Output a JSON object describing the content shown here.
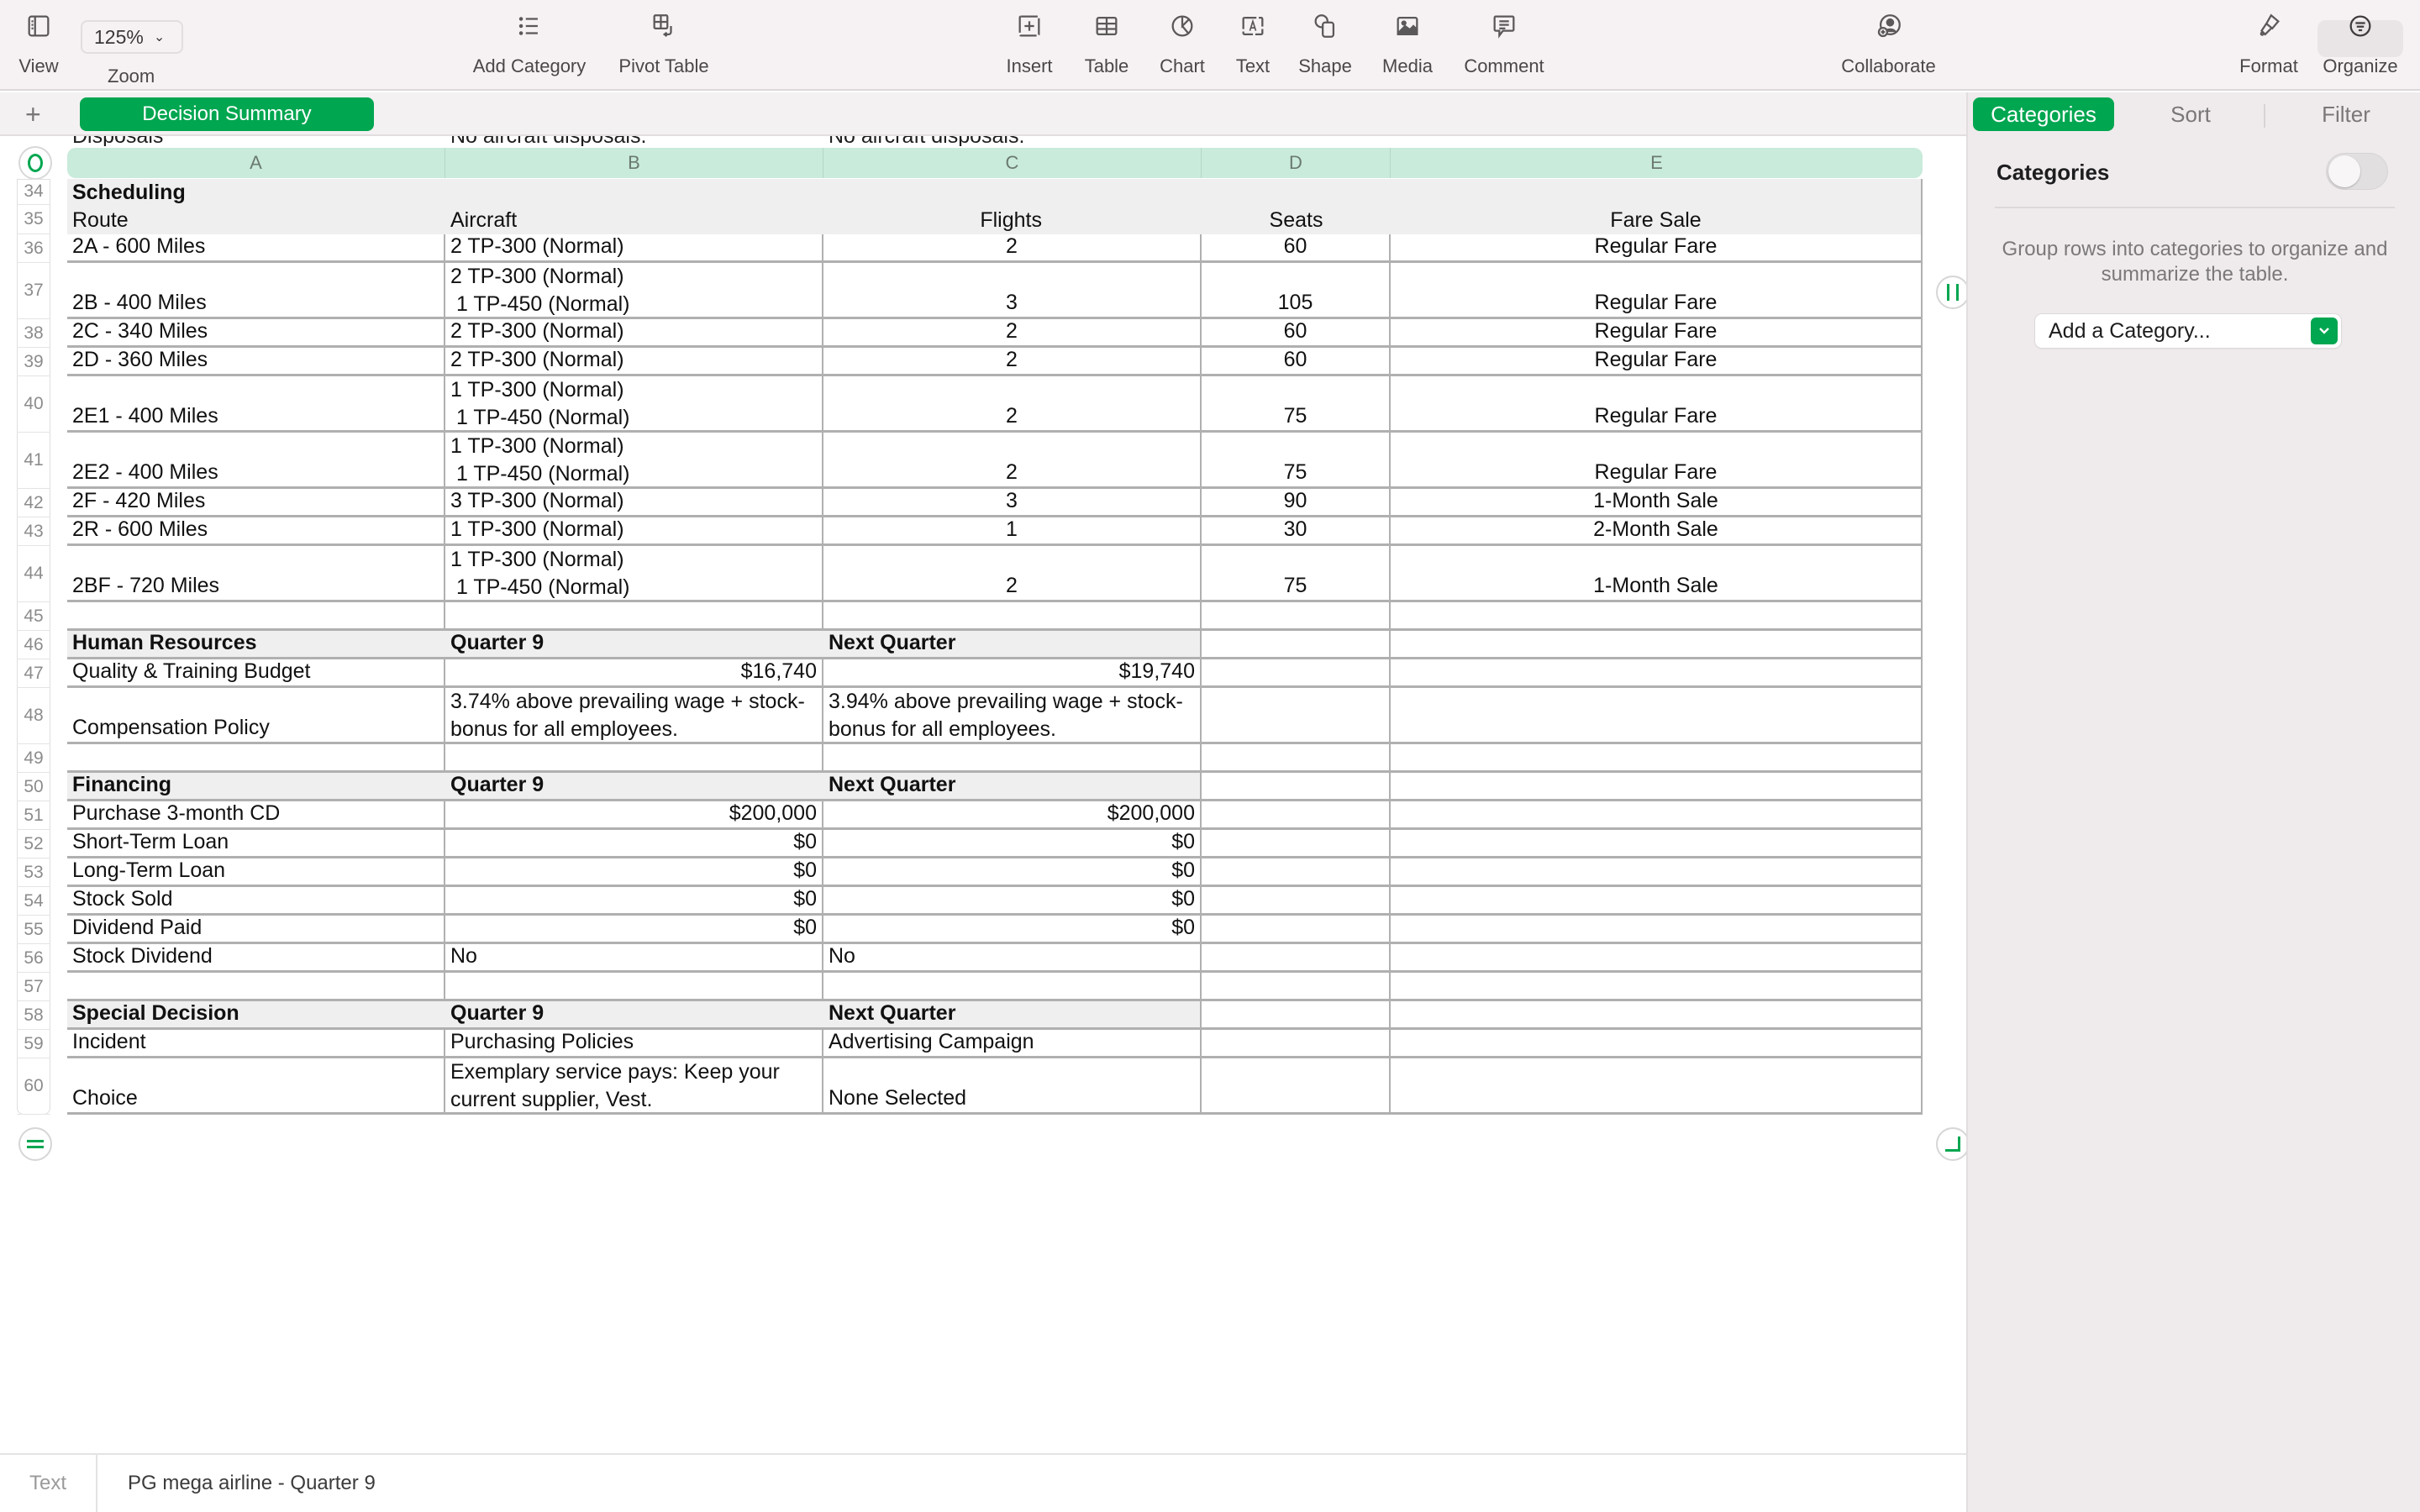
{
  "toolbar": {
    "view_label": "View",
    "zoom_value": "125%",
    "zoom_label": "Zoom",
    "add_category_label": "Add Category",
    "pivot_table_label": "Pivot Table",
    "insert_label": "Insert",
    "table_label": "Table",
    "chart_label": "Chart",
    "text_label": "Text",
    "shape_label": "Shape",
    "media_label": "Media",
    "comment_label": "Comment",
    "collaborate_label": "Collaborate",
    "format_label": "Format",
    "organize_label": "Organize"
  },
  "sheets": {
    "add_icon": "+",
    "active_tab": "Decision Summary"
  },
  "table": {
    "columns": [
      "A",
      "B",
      "C",
      "D",
      "E"
    ],
    "peek_row": {
      "a": "Disposals",
      "b": "No aircraft disposals.",
      "c": "No aircraft disposals."
    },
    "rows": [
      {
        "num": "34",
        "a": "Scheduling",
        "b": "",
        "c": "",
        "d": "",
        "e": ""
      },
      {
        "num": "35",
        "a": "Route",
        "b": "Aircraft",
        "c": "Flights",
        "d": "Seats",
        "e": "Fare Sale"
      },
      {
        "num": "36",
        "a": "2A - 600 Miles",
        "b": "2 TP-300 (Normal)",
        "c": "2",
        "d": "60",
        "e": "Regular Fare"
      },
      {
        "num": "37",
        "a": "2B - 400 Miles",
        "b": "2 TP-300 (Normal)\n 1 TP-450 (Normal)",
        "c": "3",
        "d": "105",
        "e": "Regular Fare"
      },
      {
        "num": "38",
        "a": "2C - 340 Miles",
        "b": "2 TP-300 (Normal)",
        "c": "2",
        "d": "60",
        "e": "Regular Fare"
      },
      {
        "num": "39",
        "a": "2D - 360 Miles",
        "b": "2 TP-300 (Normal)",
        "c": "2",
        "d": "60",
        "e": "Regular Fare"
      },
      {
        "num": "40",
        "a": "2E1 - 400 Miles",
        "b": "1 TP-300 (Normal)\n 1 TP-450 (Normal)",
        "c": "2",
        "d": "75",
        "e": "Regular Fare"
      },
      {
        "num": "41",
        "a": "2E2 - 400 Miles",
        "b": "1 TP-300 (Normal)\n 1 TP-450 (Normal)",
        "c": "2",
        "d": "75",
        "e": "Regular Fare"
      },
      {
        "num": "42",
        "a": "2F - 420 Miles",
        "b": "3 TP-300 (Normal)",
        "c": "3",
        "d": "90",
        "e": "1-Month Sale"
      },
      {
        "num": "43",
        "a": "2R - 600 Miles",
        "b": "1 TP-300 (Normal)",
        "c": "1",
        "d": "30",
        "e": "2-Month Sale"
      },
      {
        "num": "44",
        "a": "2BF - 720 Miles",
        "b": "1 TP-300 (Normal)\n 1 TP-450 (Normal)",
        "c": "2",
        "d": "75",
        "e": "1-Month Sale"
      },
      {
        "num": "45",
        "a": "",
        "b": "",
        "c": "",
        "d": "",
        "e": ""
      },
      {
        "num": "46",
        "a": "Human Resources",
        "b": "Quarter 9",
        "c": "Next Quarter",
        "d": "",
        "e": ""
      },
      {
        "num": "47",
        "a": "Quality & Training Budget",
        "b": "$16,740",
        "c": "$19,740",
        "d": "",
        "e": ""
      },
      {
        "num": "48",
        "a": "Compensation Policy",
        "b": "3.74% above prevailing wage + stock-\nbonus for all employees.",
        "c": "3.94% above prevailing wage + stock-\nbonus for all employees.",
        "d": "",
        "e": ""
      },
      {
        "num": "49",
        "a": "",
        "b": "",
        "c": "",
        "d": "",
        "e": ""
      },
      {
        "num": "50",
        "a": "Financing",
        "b": "Quarter 9",
        "c": "Next Quarter",
        "d": "",
        "e": ""
      },
      {
        "num": "51",
        "a": "Purchase 3-month CD",
        "b": "$200,000",
        "c": "$200,000",
        "d": "",
        "e": ""
      },
      {
        "num": "52",
        "a": "Short-Term Loan",
        "b": "$0",
        "c": "$0",
        "d": "",
        "e": ""
      },
      {
        "num": "53",
        "a": "Long-Term Loan",
        "b": "$0",
        "c": "$0",
        "d": "",
        "e": ""
      },
      {
        "num": "54",
        "a": "Stock Sold",
        "b": "$0",
        "c": "$0",
        "d": "",
        "e": ""
      },
      {
        "num": "55",
        "a": "Dividend Paid",
        "b": "$0",
        "c": "$0",
        "d": "",
        "e": ""
      },
      {
        "num": "56",
        "a": "Stock Dividend",
        "b": "No",
        "c": "No",
        "d": "",
        "e": ""
      },
      {
        "num": "57",
        "a": "",
        "b": "",
        "c": "",
        "d": "",
        "e": ""
      },
      {
        "num": "58",
        "a": "Special Decision",
        "b": "Quarter 9",
        "c": "Next Quarter",
        "d": "",
        "e": ""
      },
      {
        "num": "59",
        "a": "Incident",
        "b": "Purchasing Policies",
        "c": "Advertising Campaign",
        "d": "",
        "e": ""
      },
      {
        "num": "60",
        "a": "Choice",
        "b": "Exemplary service pays: Keep your\ncurrent supplier, Vest.",
        "c": "None Selected",
        "d": "",
        "e": ""
      }
    ]
  },
  "panel": {
    "tabs": [
      "Categories",
      "Sort",
      "Filter"
    ],
    "active_tab": "Categories",
    "section_title": "Categories",
    "toggle_on": false,
    "description": "Group rows into categories to organize and summarize the table.",
    "add_category_placeholder": "Add a Category..."
  },
  "bottombar": {
    "label": "Text",
    "value": "PG mega airline - Quarter 9"
  },
  "colors": {
    "accent": "#00a650",
    "column_header_bg": "#c9ebdb",
    "section_header_bg": "#efefef"
  }
}
